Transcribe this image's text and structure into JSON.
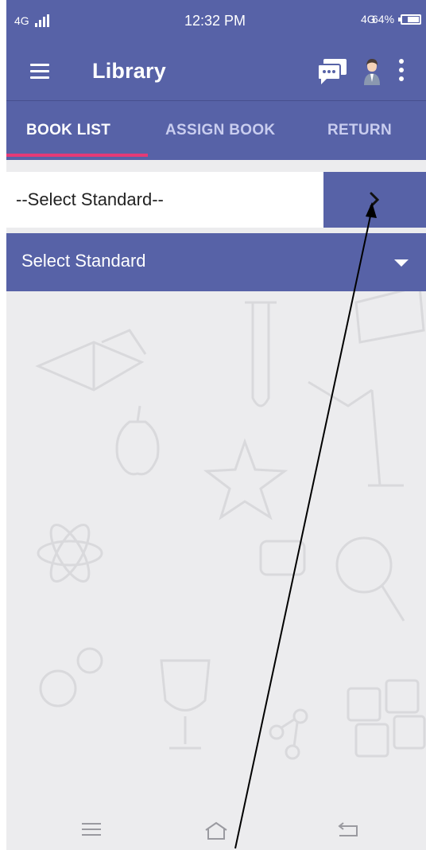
{
  "status_bar": {
    "signal_label": "4G",
    "time": "12:32 PM",
    "network": "4G",
    "battery": "64%"
  },
  "app_bar": {
    "title": "Library",
    "icons": [
      "menu-icon",
      "chat-icon",
      "user-avatar-icon",
      "more-vertical-icon"
    ]
  },
  "tabs": [
    {
      "label": "BOOK LIST",
      "active": true
    },
    {
      "label": "ASSIGN BOOK",
      "active": false
    },
    {
      "label": "RETURN",
      "active": false
    }
  ],
  "selector": {
    "value": "--Select Standard--",
    "go_icon": "chevron-right-icon"
  },
  "dropdown": {
    "label": "Select Standard",
    "icon": "caret-down-icon"
  },
  "nav_bar": {
    "icons": [
      "menu-lines-icon",
      "home-icon",
      "back-icon"
    ]
  },
  "colors": {
    "primary": "#5762a7",
    "tab_indicator": "#e53a76",
    "background": "#ececee"
  }
}
